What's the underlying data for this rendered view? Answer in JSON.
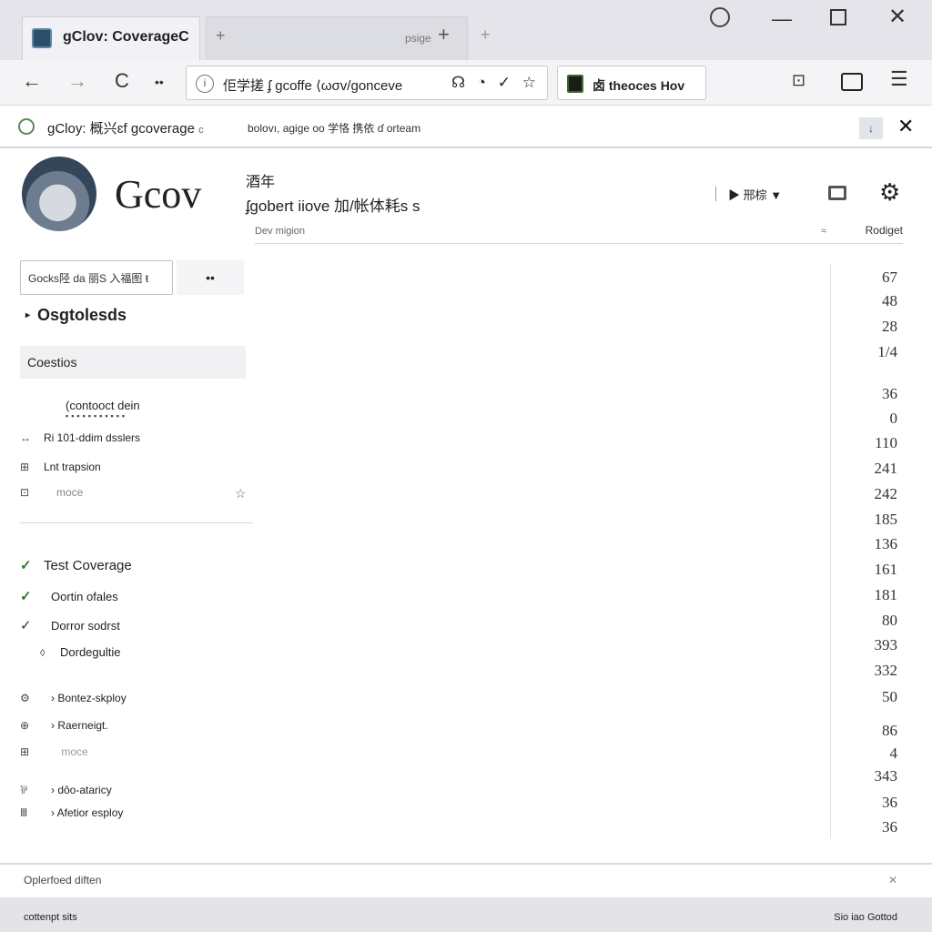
{
  "window": {
    "tabs": [
      {
        "title": "gClov: CoverageC",
        "active": true
      },
      {
        "title": "psige",
        "active": false
      }
    ],
    "new_tab": "+",
    "controls": {
      "minimize": "—",
      "maximize": "",
      "close": "✕"
    }
  },
  "navbar": {
    "back": "←",
    "forward": "→",
    "reload": "C",
    "more": "••",
    "url": "佢学搓 ʄ gcoffe  ⟨ωσv/gonceve",
    "url_icons": "☊ ◔ ✓ ☆",
    "bookmark_chip": "卤  theoces Hov"
  },
  "infobar": {
    "title": "gCloy: 概兴ɛf  gcoverage",
    "title_suffix": "c",
    "message": "bolovı, agige oo  学恪 携依 ɗ orteam",
    "pin": "↓",
    "close": "✕"
  },
  "header": {
    "brand": "Gcov",
    "line1": "酒年",
    "line2": "ʄgobert iiove  加/帐体耗s s",
    "dropdown": "▶ 邢棕  ▼",
    "gear": "⚙",
    "col_left": "Dev  migion",
    "col_dot": "≈",
    "col_right": "Rodiget"
  },
  "sidebar": {
    "filter_text": "Gocks陉 da  丽S  入福图 ŧ",
    "filter_button": "••",
    "tree_caret": "▸",
    "tree_title": "Osgtolesds",
    "section": "Coestios",
    "subhead": "(contooct dein",
    "subhead_dots": "▪▪▪▪▪▪▪▪▪▪▪",
    "rows": [
      {
        "icon": "↔",
        "label": "Ri  101-ddim dsslers"
      },
      {
        "icon": "⊞",
        "label": "Lnt trapsion"
      },
      {
        "icon": "⊡",
        "label": "moce"
      }
    ],
    "star": "☆",
    "checks": [
      {
        "icon": "✓",
        "label": "Test Coverage"
      },
      {
        "icon": "✓",
        "label": "Oortin ofales"
      },
      {
        "icon": "✓",
        "label": "Dorror sodrst"
      },
      {
        "icon": "◊",
        "label": "Dordegultie"
      }
    ],
    "items": [
      {
        "icon": "⚙",
        "label": "› Bontez-skploy"
      },
      {
        "icon": "⊕",
        "label": "› Raerneigt."
      },
      {
        "icon": "⊞",
        "label": "  moce"
      },
      {
        "icon": "⅌",
        "label": "› dôo-ataricy"
      },
      {
        "icon": "Ⅲ",
        "label": "› Afetior esploy"
      }
    ]
  },
  "numbers": [
    "67",
    "48",
    "28",
    "1/4",
    "36",
    "0",
    "110",
    "241",
    "242",
    "185",
    "136",
    "161",
    "181",
    "80",
    "393",
    "332",
    "50",
    "86",
    "4",
    "343",
    "36",
    "36"
  ],
  "footer": {
    "text": "Oplerfoed  diften",
    "close": "✕"
  },
  "statusbar": {
    "left": "cottenpt sits",
    "right": "Sio iao Gottod"
  }
}
